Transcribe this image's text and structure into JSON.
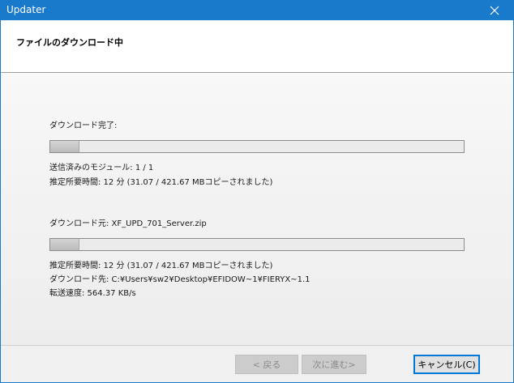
{
  "window": {
    "title": "Updater",
    "accent_color": "#1979ca"
  },
  "header": {
    "title": "ファイルのダウンロード中"
  },
  "overall": {
    "label": "ダウンロード完了:",
    "progress_fraction": 0.07,
    "modules_sent": "送信済みのモジュール: 1 / 1",
    "estimated_time": "推定所要時間: 12 分 (31.07 / 421.67 MBコピーされました)"
  },
  "file": {
    "source_label": "ダウンロード元:  XF_UPD_701_Server.zip",
    "progress_fraction": 0.07,
    "estimated_time": "推定所要時間: 12 分 (31.07 / 421.67 MBコピーされました)",
    "destination": "ダウンロード先: C:¥Users¥sw2¥Desktop¥EFIDOW~1¥FIERYX~1.1",
    "transfer_speed": "転送速度: 564.37 KB/s"
  },
  "buttons": {
    "back_label": "< 戻る",
    "next_label": "次に進む>",
    "cancel_label": "キャンセル(C)"
  },
  "icons": {
    "close": "close-icon"
  }
}
